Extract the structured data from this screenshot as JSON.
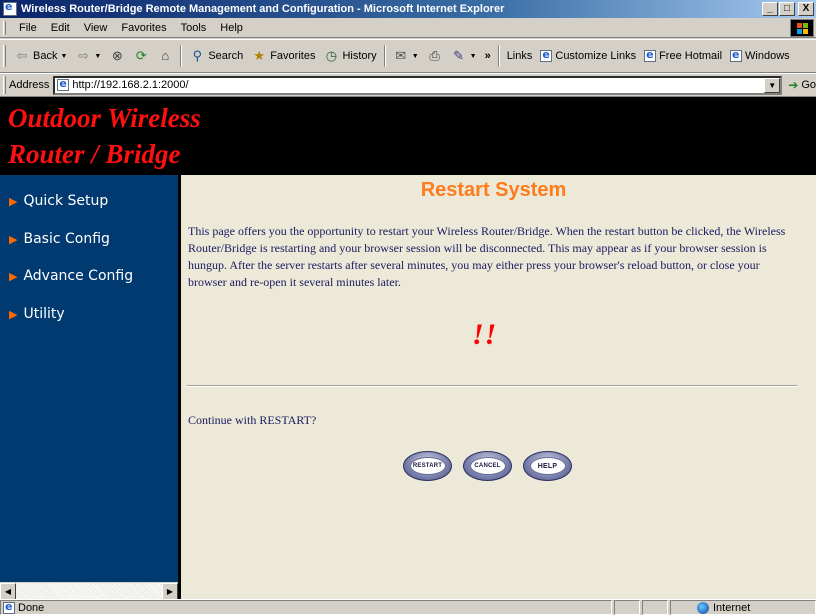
{
  "window": {
    "title": "Wireless Router/Bridge Remote Management and Configuration - Microsoft Internet Explorer",
    "minimize": "_",
    "maximize": "□",
    "close": "X"
  },
  "menu": {
    "file": "File",
    "edit": "Edit",
    "view": "View",
    "favorites": "Favorites",
    "tools": "Tools",
    "help": "Help"
  },
  "toolbar": {
    "back": "Back",
    "search": "Search",
    "favorites": "Favorites",
    "history": "History",
    "more": "»",
    "links": "Links",
    "customize_links": "Customize Links",
    "free_hotmail": "Free Hotmail",
    "windows": "Windows"
  },
  "address": {
    "label": "Address",
    "url": "http://192.168.2.1:2000/",
    "go": "Go"
  },
  "banner": {
    "line1": "Outdoor Wireless",
    "line2": "Router / Bridge",
    "color": "#ff1010"
  },
  "nav": {
    "items": [
      {
        "label": "Quick Setup"
      },
      {
        "label": "Basic Config"
      },
      {
        "label": "Advance Config"
      },
      {
        "label": "Utility"
      }
    ],
    "arrow": "▶",
    "background": "#003a70"
  },
  "main": {
    "title": "Restart System",
    "description": "This page offers you the opportunity to restart your Wireless Router/Bridge. When the restart button be clicked, the Wireless Router/Bridge is restarting and your browser session will be disconnected. This may appear as if your browser session is hungup. After the server restarts after several minutes, you may either press your browser's reload button, or close your browser and re-open it several minutes later.",
    "warning": "!!",
    "confirm": "Continue with RESTART?",
    "buttons": {
      "restart": "RESTART",
      "cancel": "CANCEL",
      "help": "HELP"
    },
    "title_color": "#ff7b1c",
    "background": "#ece9d8"
  },
  "status": {
    "text": "Done",
    "zone": "Internet"
  }
}
